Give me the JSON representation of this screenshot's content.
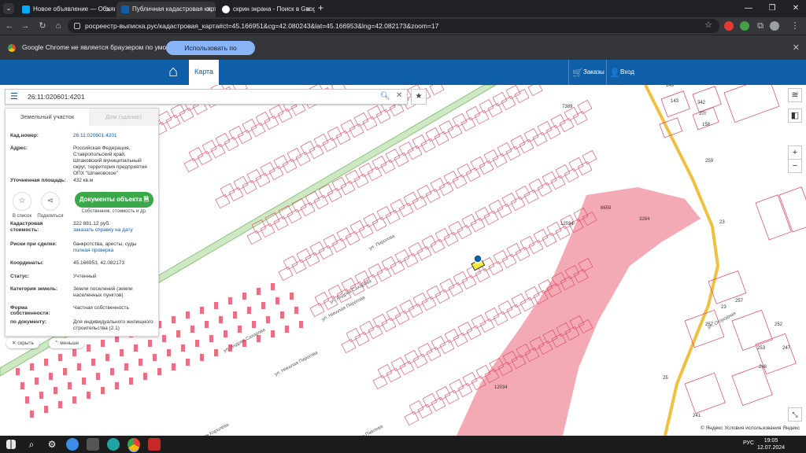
{
  "browser": {
    "tabs": [
      {
        "title": "Новое объявление — Объяв",
        "favicon_color": "#00aaff"
      },
      {
        "title": "Публичная кадастровая карта",
        "favicon_color": "#0e5fa8"
      },
      {
        "title": "скрин экрана - Поиск в Google",
        "favicon_color": "#ffffff"
      }
    ],
    "url": "росреестр-выписка.рус/кадастровая_карта#ct=45.166951&cg=42.080243&lat=45.166953&lng=42.082173&zoom=17",
    "infobar_text": "Google Chrome не является браузером по умолчанию.",
    "infobar_button": "Использовать по умолчанию"
  },
  "site": {
    "map_tab": "Карта",
    "orders": "Заказы",
    "login": "Вход"
  },
  "search": {
    "value": "26:11:020601:4201"
  },
  "panel": {
    "tab_land": "Земельный участок",
    "tab_building": "Дом (здание)",
    "cad_label": "Кад.номер:",
    "cad_value": "26:11:020601:4201",
    "address_label": "Адрес:",
    "address_value": "Российская Федерация, Ставропольский край, Шпаковский муниципальный округ, территория предприятия ОПХ \"Шпаковское\"",
    "area_label": "Уточненная площадь:",
    "area_value": "432 кв.м",
    "btn_list": "В список",
    "btn_share": "Поделиться",
    "btn_docs": "Документы объекта",
    "docs_sub": "Собственник, стоимость и др.",
    "cost_label": "Кадастровая стоимость:",
    "cost_value": "322 881.12 руб.",
    "cost_link": "заказать справку на дату",
    "risks_label": "Риски при сделке:",
    "risks_value": "банкротства, аресты, суды",
    "risks_link": "полная проверка",
    "coords_label": "Координаты:",
    "coords_value": "45.166953, 42.082173",
    "status_label": "Статус:",
    "status_value": "Учтенный",
    "category_label": "Категория земель:",
    "category_value": "Земли поселений (земли населенных пунктов)",
    "ownership_label": "Форма собственности:",
    "ownership_value": "Частная собственность",
    "doc_label": "по документу:",
    "doc_value": "Для индивидуального жилищного строительства (2.1)",
    "hide": "скрыть",
    "less": "меньше"
  },
  "map": {
    "labels": [
      "7389",
      "12034",
      "12034",
      "6659",
      "3284",
      "143",
      "342",
      "20т",
      "158",
      "146",
      "259",
      "23",
      "257",
      "257",
      "252",
      "253",
      "247",
      "248",
      "241",
      "25",
      "12234",
      "23"
    ],
    "streets": [
      "ул. Андрея Сахарова",
      "ул. Николая Пирогова",
      "ул. Андрея Сахарова",
      "ул. Николая Пирогова",
      "ул. Ивана Павлова",
      "ул. Сергея Королёва",
      "ул. Пирогова",
      "ул. Огородная"
    ],
    "attribution": "© Яндекс Условия использования  Яндекс",
    "colors": {
      "parcel": "#e0405a",
      "zone": "#f4aab4",
      "road": "#f0c040",
      "green": "#8bc47a"
    }
  },
  "taskbar": {
    "lang": "РУС",
    "time": "19:05",
    "date": "12.07.2024"
  }
}
